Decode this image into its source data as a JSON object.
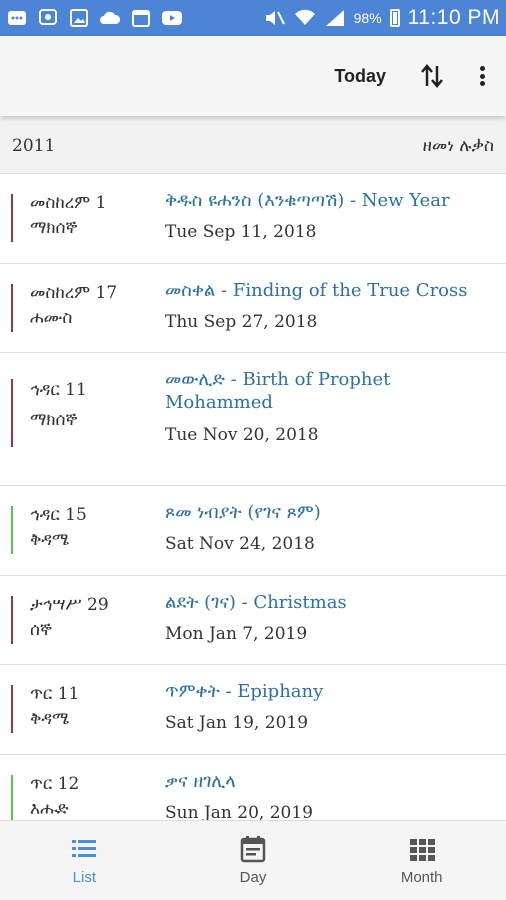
{
  "status_bar": {
    "icons": [
      "chat-icon",
      "messenger-icon",
      "gallery-icon",
      "cloud-icon",
      "calendar-icon",
      "youtube-icon"
    ],
    "right_icons": [
      "mute-icon",
      "wifi-icon",
      "signal-icon"
    ],
    "battery": "98%",
    "time": "11:10 PM"
  },
  "toolbar": {
    "today_label": "Today",
    "sort_icon": "sort-icon",
    "more_icon": "more-vert-icon"
  },
  "year_header": {
    "year": "2011",
    "label": "ዘመነ ሉቃስ"
  },
  "colors": {
    "accent": "#4a8fd6",
    "status_bar": "#4c85d6",
    "event_text": "#2c6fa8",
    "holiday_bar": "#8b3a4a",
    "fast_bar": "#5cbf5c"
  },
  "events": [
    {
      "eth_date": "መስከረም 1",
      "eth_day": "ማክሰኞ",
      "title": "ቅዱስ ዩሐንስ (እንቁጣጣሽ) - New Year",
      "date": "Tue Sep 11, 2018",
      "bar": "holiday"
    },
    {
      "eth_date": "መስከረም 17",
      "eth_day": "ሐሙስ",
      "title": "መስቀል - Finding of the True Cross",
      "date": "Thu Sep 27, 2018",
      "bar": "holiday"
    },
    {
      "eth_date": "ኅዳር 11",
      "eth_day": "ማክሰኞ",
      "title": "መውሊድ - Birth of Prophet Mohammed",
      "date": "Tue Nov 20, 2018",
      "bar": "holiday"
    },
    {
      "eth_date": "ኅዳር 15",
      "eth_day": "ቅዳሜ",
      "title": "ጾመ ነብያት (የገና ጾም)",
      "date": "Sat Nov 24, 2018",
      "bar": "fast"
    },
    {
      "eth_date": "ታኅሣሥ 29",
      "eth_day": "ሰኞ",
      "title": "ልደት (ገና) - Christmas",
      "date": "Mon Jan 7, 2019",
      "bar": "holiday"
    },
    {
      "eth_date": "ጥር 11",
      "eth_day": "ቅዳሜ",
      "title": "ጥምቀት - Epiphany",
      "date": "Sat Jan 19, 2019",
      "bar": "holiday"
    },
    {
      "eth_date": "ጥር 12",
      "eth_day": "እሑድ",
      "title": "ቃና ዘገሊላ",
      "date": "Sun Jan 20, 2019",
      "bar": "fast"
    }
  ],
  "bottom_nav": [
    {
      "label": "List",
      "icon": "list-icon",
      "active": true
    },
    {
      "label": "Day",
      "icon": "calendar-day-icon",
      "active": false
    },
    {
      "label": "Month",
      "icon": "grid-icon",
      "active": false
    }
  ]
}
